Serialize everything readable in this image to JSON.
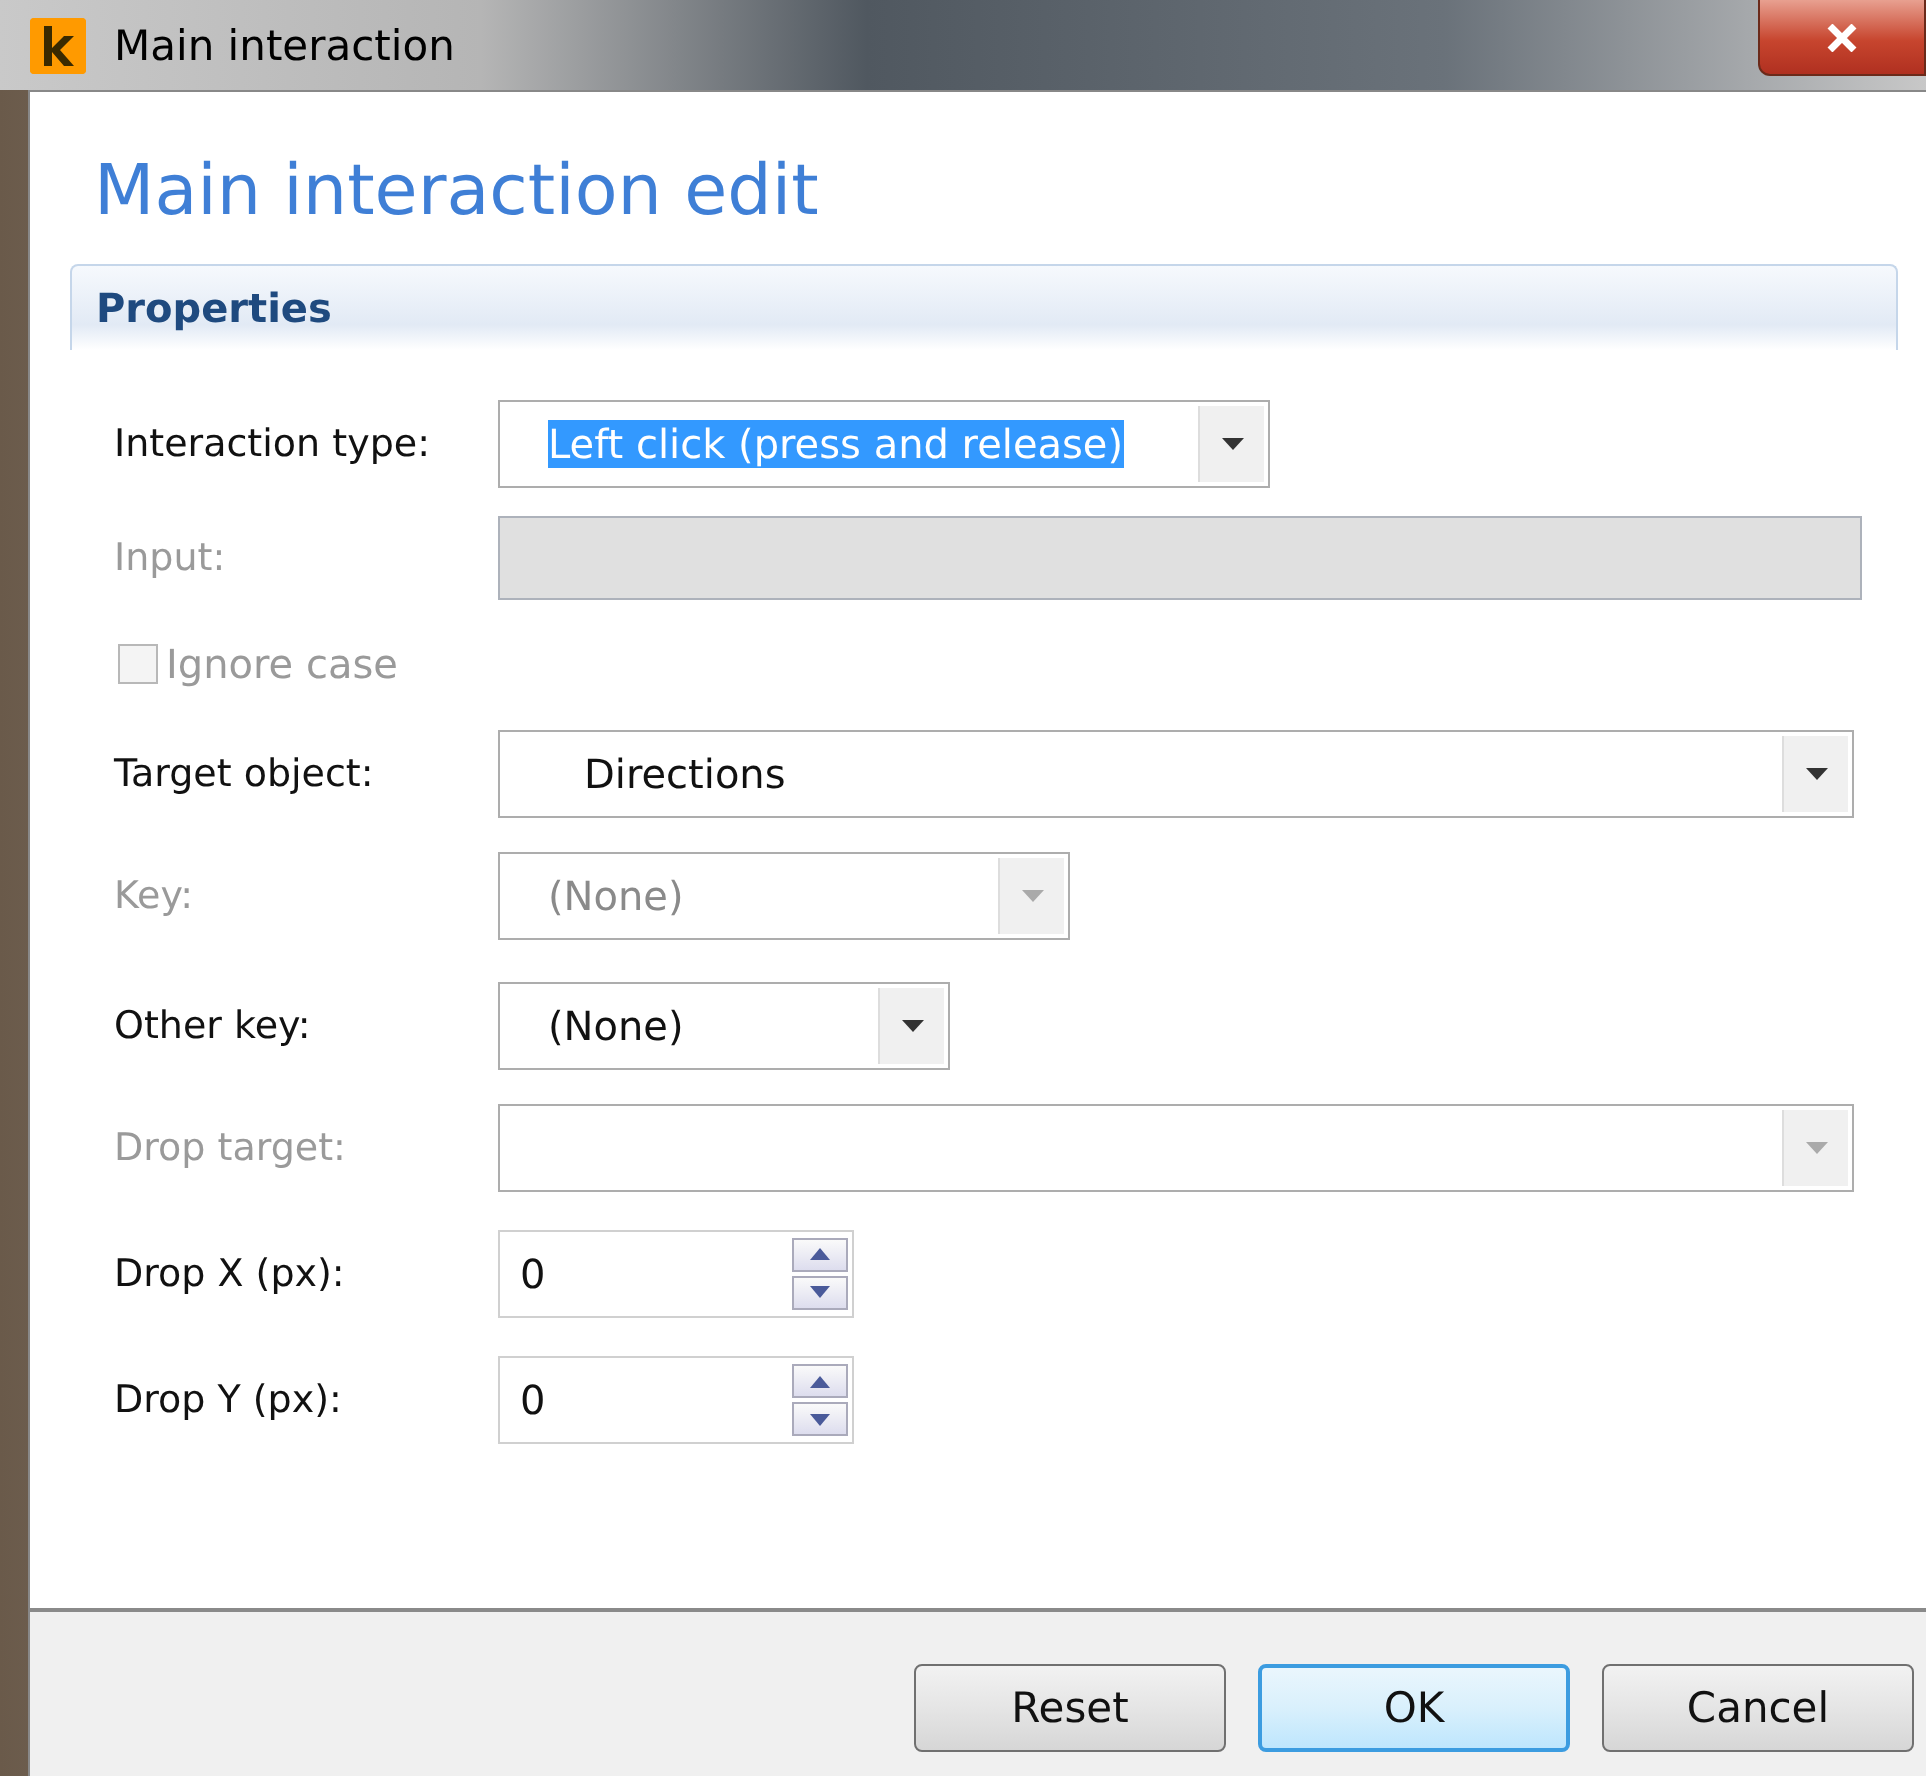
{
  "window": {
    "title": "Main interaction"
  },
  "heading": "Main interaction edit",
  "section": "Properties",
  "fields": [
    {
      "kind": "dropdown",
      "label": "Interaction type:",
      "value": "Left click (press and release)",
      "highlighted": true,
      "disabled": false
    },
    {
      "kind": "text",
      "label": "Input:",
      "disabled": true
    },
    {
      "kind": "checkbox",
      "label": "Ignore case",
      "checked": false,
      "disabled": true
    },
    {
      "kind": "dropdown",
      "label": "Target object:",
      "value": "Directions",
      "highlighted": false,
      "disabled": false
    },
    {
      "kind": "dropdown",
      "label": "Key:",
      "value": "(None)",
      "highlighted": false,
      "disabled": true
    },
    {
      "kind": "dropdown",
      "label": "Other key:",
      "value": "(None)",
      "highlighted": false,
      "disabled": false
    },
    {
      "kind": "dropdown",
      "label": "Drop target:",
      "disabled": true
    },
    {
      "kind": "spin",
      "label": "Drop X (px):",
      "value": "0",
      "disabled": false
    },
    {
      "kind": "spin",
      "label": "Drop Y (px):",
      "value": "0",
      "disabled": false
    }
  ],
  "buttons": [
    {
      "label": "Reset",
      "default": false
    },
    {
      "label": "OK",
      "default": true
    },
    {
      "label": "Cancel",
      "default": false
    }
  ]
}
